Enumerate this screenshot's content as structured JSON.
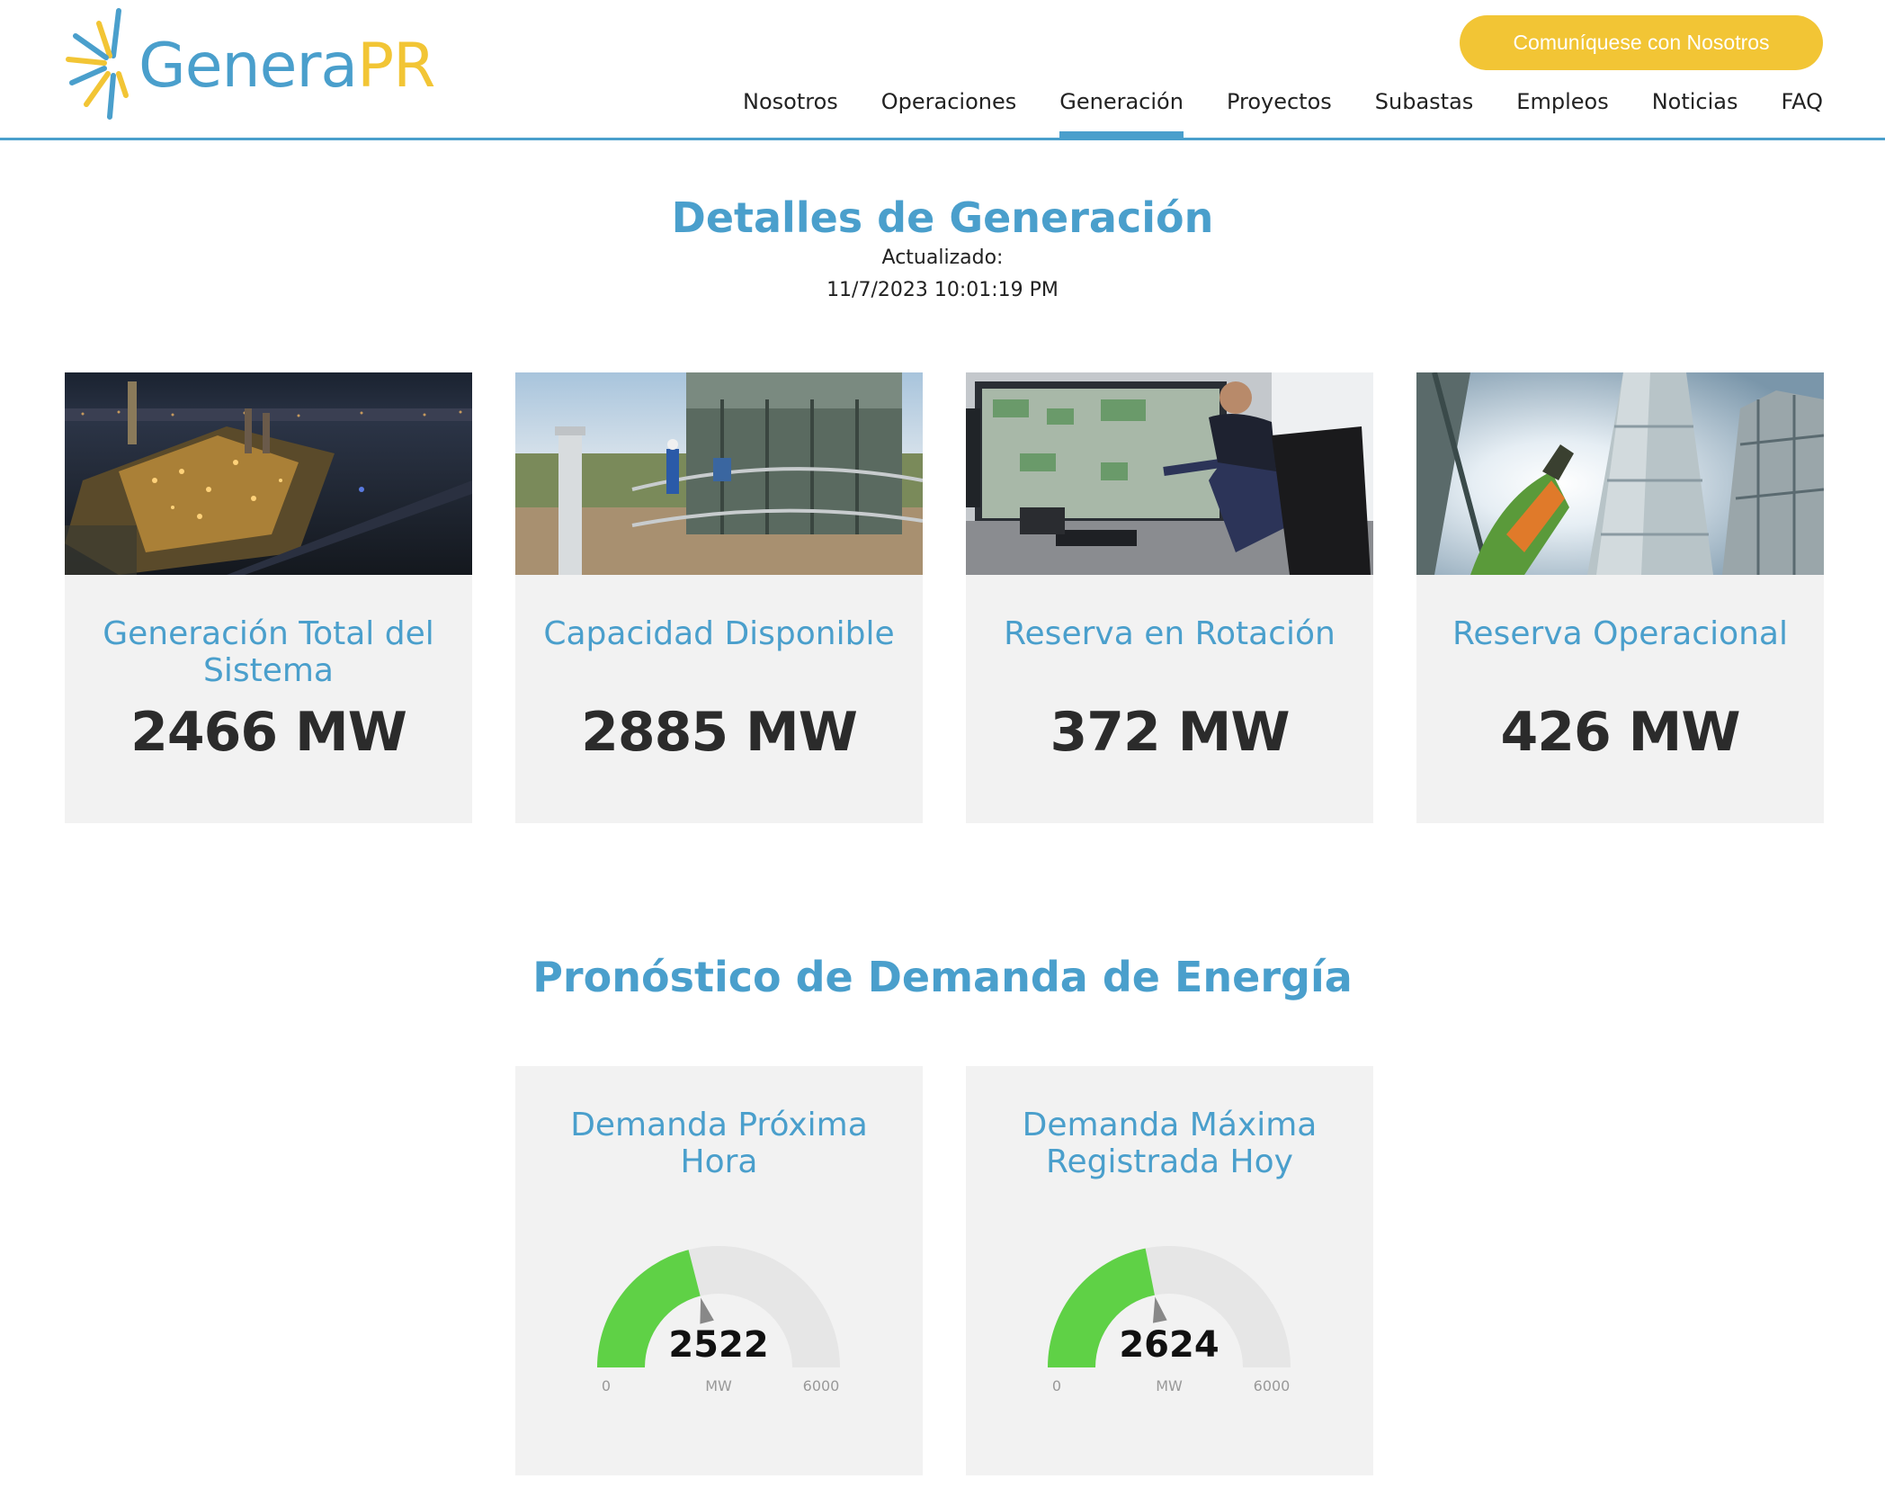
{
  "header": {
    "logo_primary": "Genera",
    "logo_secondary": "PR",
    "contact_button": "Comuníquese con Nosotros",
    "nav": [
      {
        "label": "Nosotros",
        "active": false
      },
      {
        "label": "Operaciones",
        "active": false
      },
      {
        "label": "Generación",
        "active": true
      },
      {
        "label": "Proyectos",
        "active": false
      },
      {
        "label": "Subastas",
        "active": false
      },
      {
        "label": "Empleos",
        "active": false
      },
      {
        "label": "Noticias",
        "active": false
      },
      {
        "label": "FAQ",
        "active": false
      }
    ]
  },
  "details": {
    "title": "Detalles de Generación",
    "updated_label": "Actualizado:",
    "updated_value": "11/7/2023 10:01:19 PM",
    "cards": [
      {
        "label": "Generación Total del Sistema",
        "value": "2466 MW"
      },
      {
        "label": "Capacidad Disponible",
        "value": "2885 MW"
      },
      {
        "label": "Reserva en Rotación",
        "value": "372 MW"
      },
      {
        "label": "Reserva Operacional",
        "value": "426 MW"
      }
    ]
  },
  "forecast": {
    "title": "Pronóstico de Demanda de Energía",
    "gauges": [
      {
        "label": "Demanda Próxima Hora",
        "value": "2522",
        "value_num": 2522,
        "min": "0",
        "max": "6000",
        "max_num": 6000,
        "unit": "MW"
      },
      {
        "label": "Demanda Máxima Registrada Hoy",
        "value": "2624",
        "value_num": 2624,
        "min": "0",
        "max": "6000",
        "max_num": 6000,
        "unit": "MW"
      }
    ]
  },
  "colors": {
    "brand_blue": "#4a9fcc",
    "brand_yellow": "#f2c535",
    "gauge_fill": "#5fd146",
    "gauge_track": "#e6e6e6",
    "card_bg": "#f2f2f2"
  }
}
